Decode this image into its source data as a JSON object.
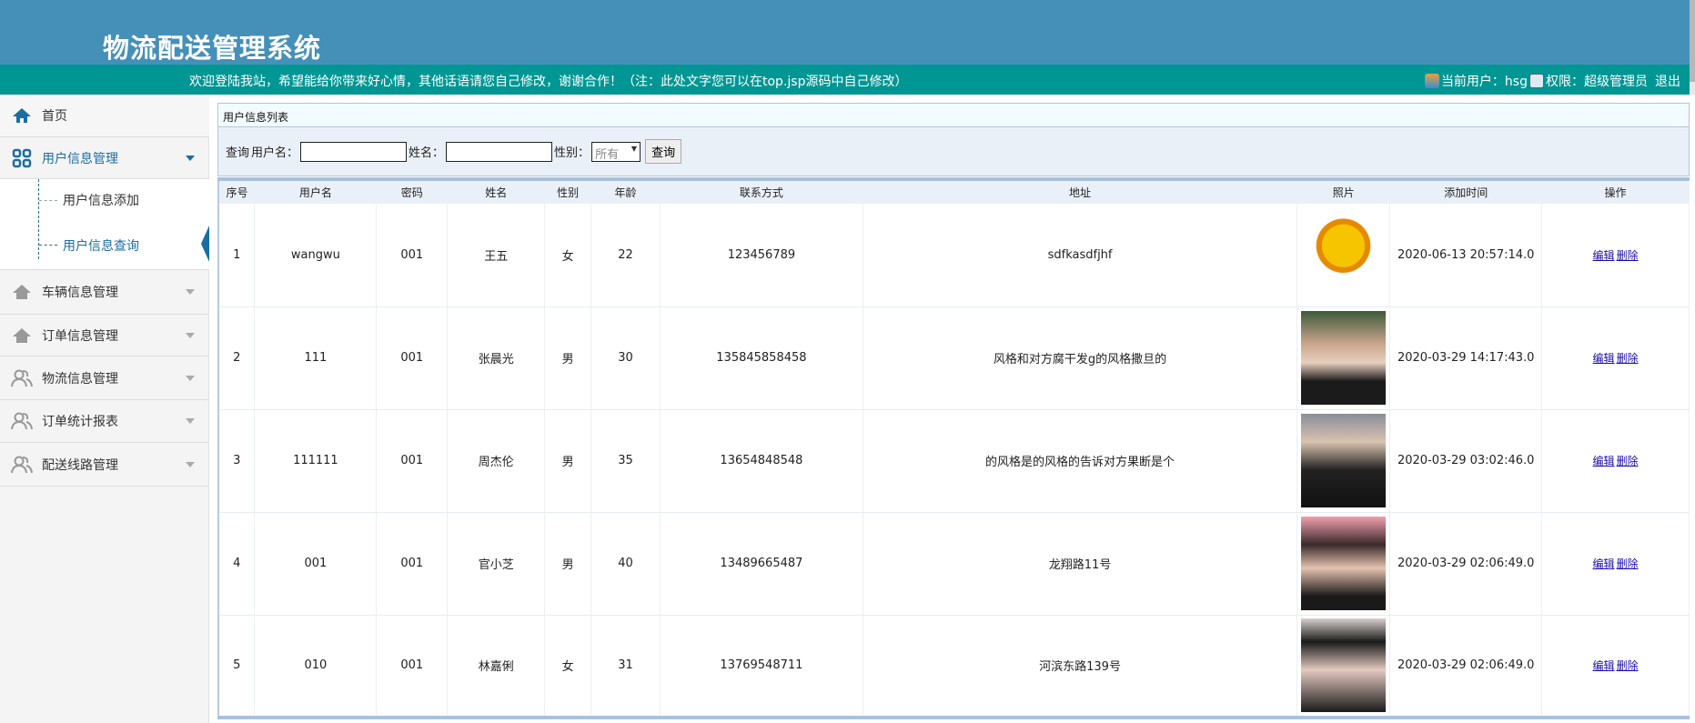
{
  "header": {
    "title": "物流配送管理系统",
    "welcome": "欢迎登陆我站，希望能给你带来好心情，其他话语请您自己修改，谢谢合作！（注：此处文字您可以在top.jsp源码中自己修改）",
    "current_user_label": "当前用户：hsg",
    "role_label": "权限：超级管理员",
    "logout": "退出"
  },
  "sidebar": {
    "home": "首页",
    "groups": [
      {
        "label": "用户信息管理",
        "icon": "grid-icon"
      },
      {
        "label": "车辆信息管理",
        "icon": "house-icon"
      },
      {
        "label": "订单信息管理",
        "icon": "house-icon"
      },
      {
        "label": "物流信息管理",
        "icon": "users-icon"
      },
      {
        "label": "订单统计报表",
        "icon": "users-icon"
      },
      {
        "label": "配送线路管理",
        "icon": "users-icon"
      }
    ],
    "sub_items": [
      "用户信息添加",
      "用户信息查询"
    ]
  },
  "main": {
    "title": "用户信息列表",
    "search": {
      "query_label": "查询",
      "username_label": "用户名：",
      "username_value": "",
      "name_label": "姓名：",
      "name_value": "",
      "gender_label": "性别：",
      "gender_selected": "所有",
      "submit": "查询"
    },
    "columns": [
      "序号",
      "用户名",
      "密码",
      "姓名",
      "性别",
      "年龄",
      "联系方式",
      "地址",
      "照片",
      "添加时间",
      "操作"
    ],
    "rows": [
      {
        "no": "1",
        "username": "wangwu",
        "password": "001",
        "name": "王五",
        "gender": "女",
        "age": "22",
        "phone": "123456789",
        "address": "sdfkasdfjhf",
        "time": "2020-06-13 20:57:14.0",
        "photo": "logo"
      },
      {
        "no": "2",
        "username": "111",
        "password": "001",
        "name": "张晨光",
        "gender": "男",
        "age": "30",
        "phone": "135845858458",
        "address": "风格和对方腐干发g的风格撒旦的",
        "time": "2020-03-29 14:17:43.0",
        "photo": "man"
      },
      {
        "no": "3",
        "username": "111111",
        "password": "001",
        "name": "周杰伦",
        "gender": "男",
        "age": "35",
        "phone": "13654848548",
        "address": "的风格是的风格的告诉对方果断是个",
        "time": "2020-03-29 03:02:46.0",
        "photo": "man2"
      },
      {
        "no": "4",
        "username": "001",
        "password": "001",
        "name": "官小芝",
        "gender": "男",
        "age": "40",
        "phone": "13489665487",
        "address": "龙翔路11号",
        "time": "2020-03-29 02:06:49.0",
        "photo": "pink"
      },
      {
        "no": "5",
        "username": "010",
        "password": "001",
        "name": "林嘉俐",
        "gender": "女",
        "age": "31",
        "phone": "13769548711",
        "address": "河滨东路139号",
        "time": "2020-03-29 02:06:49.0",
        "photo": "woman"
      }
    ],
    "edit_label": "编辑",
    "delete_label": "删除"
  },
  "colors": {
    "header": "#4590b8",
    "bar": "#009694",
    "accent": "#1c6da0"
  }
}
